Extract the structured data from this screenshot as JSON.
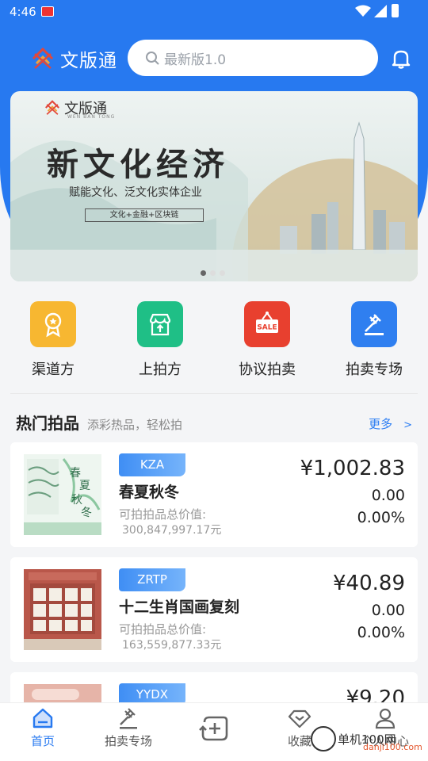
{
  "status": {
    "time": "4:46"
  },
  "header": {
    "app_name": "文版通",
    "search_placeholder": "最新版1.0"
  },
  "banner": {
    "logo_name": "文版通",
    "logo_sub": "WEN BAN TONG",
    "headline": "新文化经济",
    "subline": "赋能文化、泛文化实体企业",
    "chip": "文化+金融+区块链",
    "active_dot": 0
  },
  "quick_nav": [
    {
      "label": "渠道方",
      "icon": "award-ribbon-icon",
      "color": "#f7b731"
    },
    {
      "label": "上拍方",
      "icon": "storefront-upload-icon",
      "color": "#1fbf86"
    },
    {
      "label": "协议拍卖",
      "icon": "sale-sign-icon",
      "color": "#e8402f"
    },
    {
      "label": "拍卖专场",
      "icon": "gavel-icon",
      "color": "#2f7ff0"
    }
  ],
  "section": {
    "title": "热门拍品",
    "subtitle": "添彩热品，轻松拍",
    "more": "更多",
    "more_arrow": ">"
  },
  "products": [
    {
      "code": "KZA",
      "name": "春夏秋冬",
      "value_label": "可拍拍品总价值:",
      "value": "300,847,997.17元",
      "price": "¥1,002.83",
      "change": "0.00",
      "percent": "0.00%"
    },
    {
      "code": "ZRTP",
      "name": "十二生肖国画复刻",
      "value_label": "可拍拍品总价值:",
      "value": "163,559,877.33元",
      "price": "¥40.89",
      "change": "0.00",
      "percent": "0.00%"
    },
    {
      "code": "YYDX",
      "price": "¥9.20"
    }
  ],
  "tabs": [
    {
      "label": "首页",
      "icon": "home-icon",
      "active": true
    },
    {
      "label": "拍卖专场",
      "icon": "gavel-icon"
    },
    {
      "label": "",
      "icon": "trade-icon"
    },
    {
      "label": "收藏",
      "icon": "diamond-icon"
    },
    {
      "label": "个人中心",
      "icon": "user-icon"
    }
  ],
  "watermark": {
    "text": "单机100网",
    "url": "danji100.com"
  },
  "colors": {
    "primary": "#2779f0",
    "tag_gradient_start": "#3f8ef4"
  }
}
